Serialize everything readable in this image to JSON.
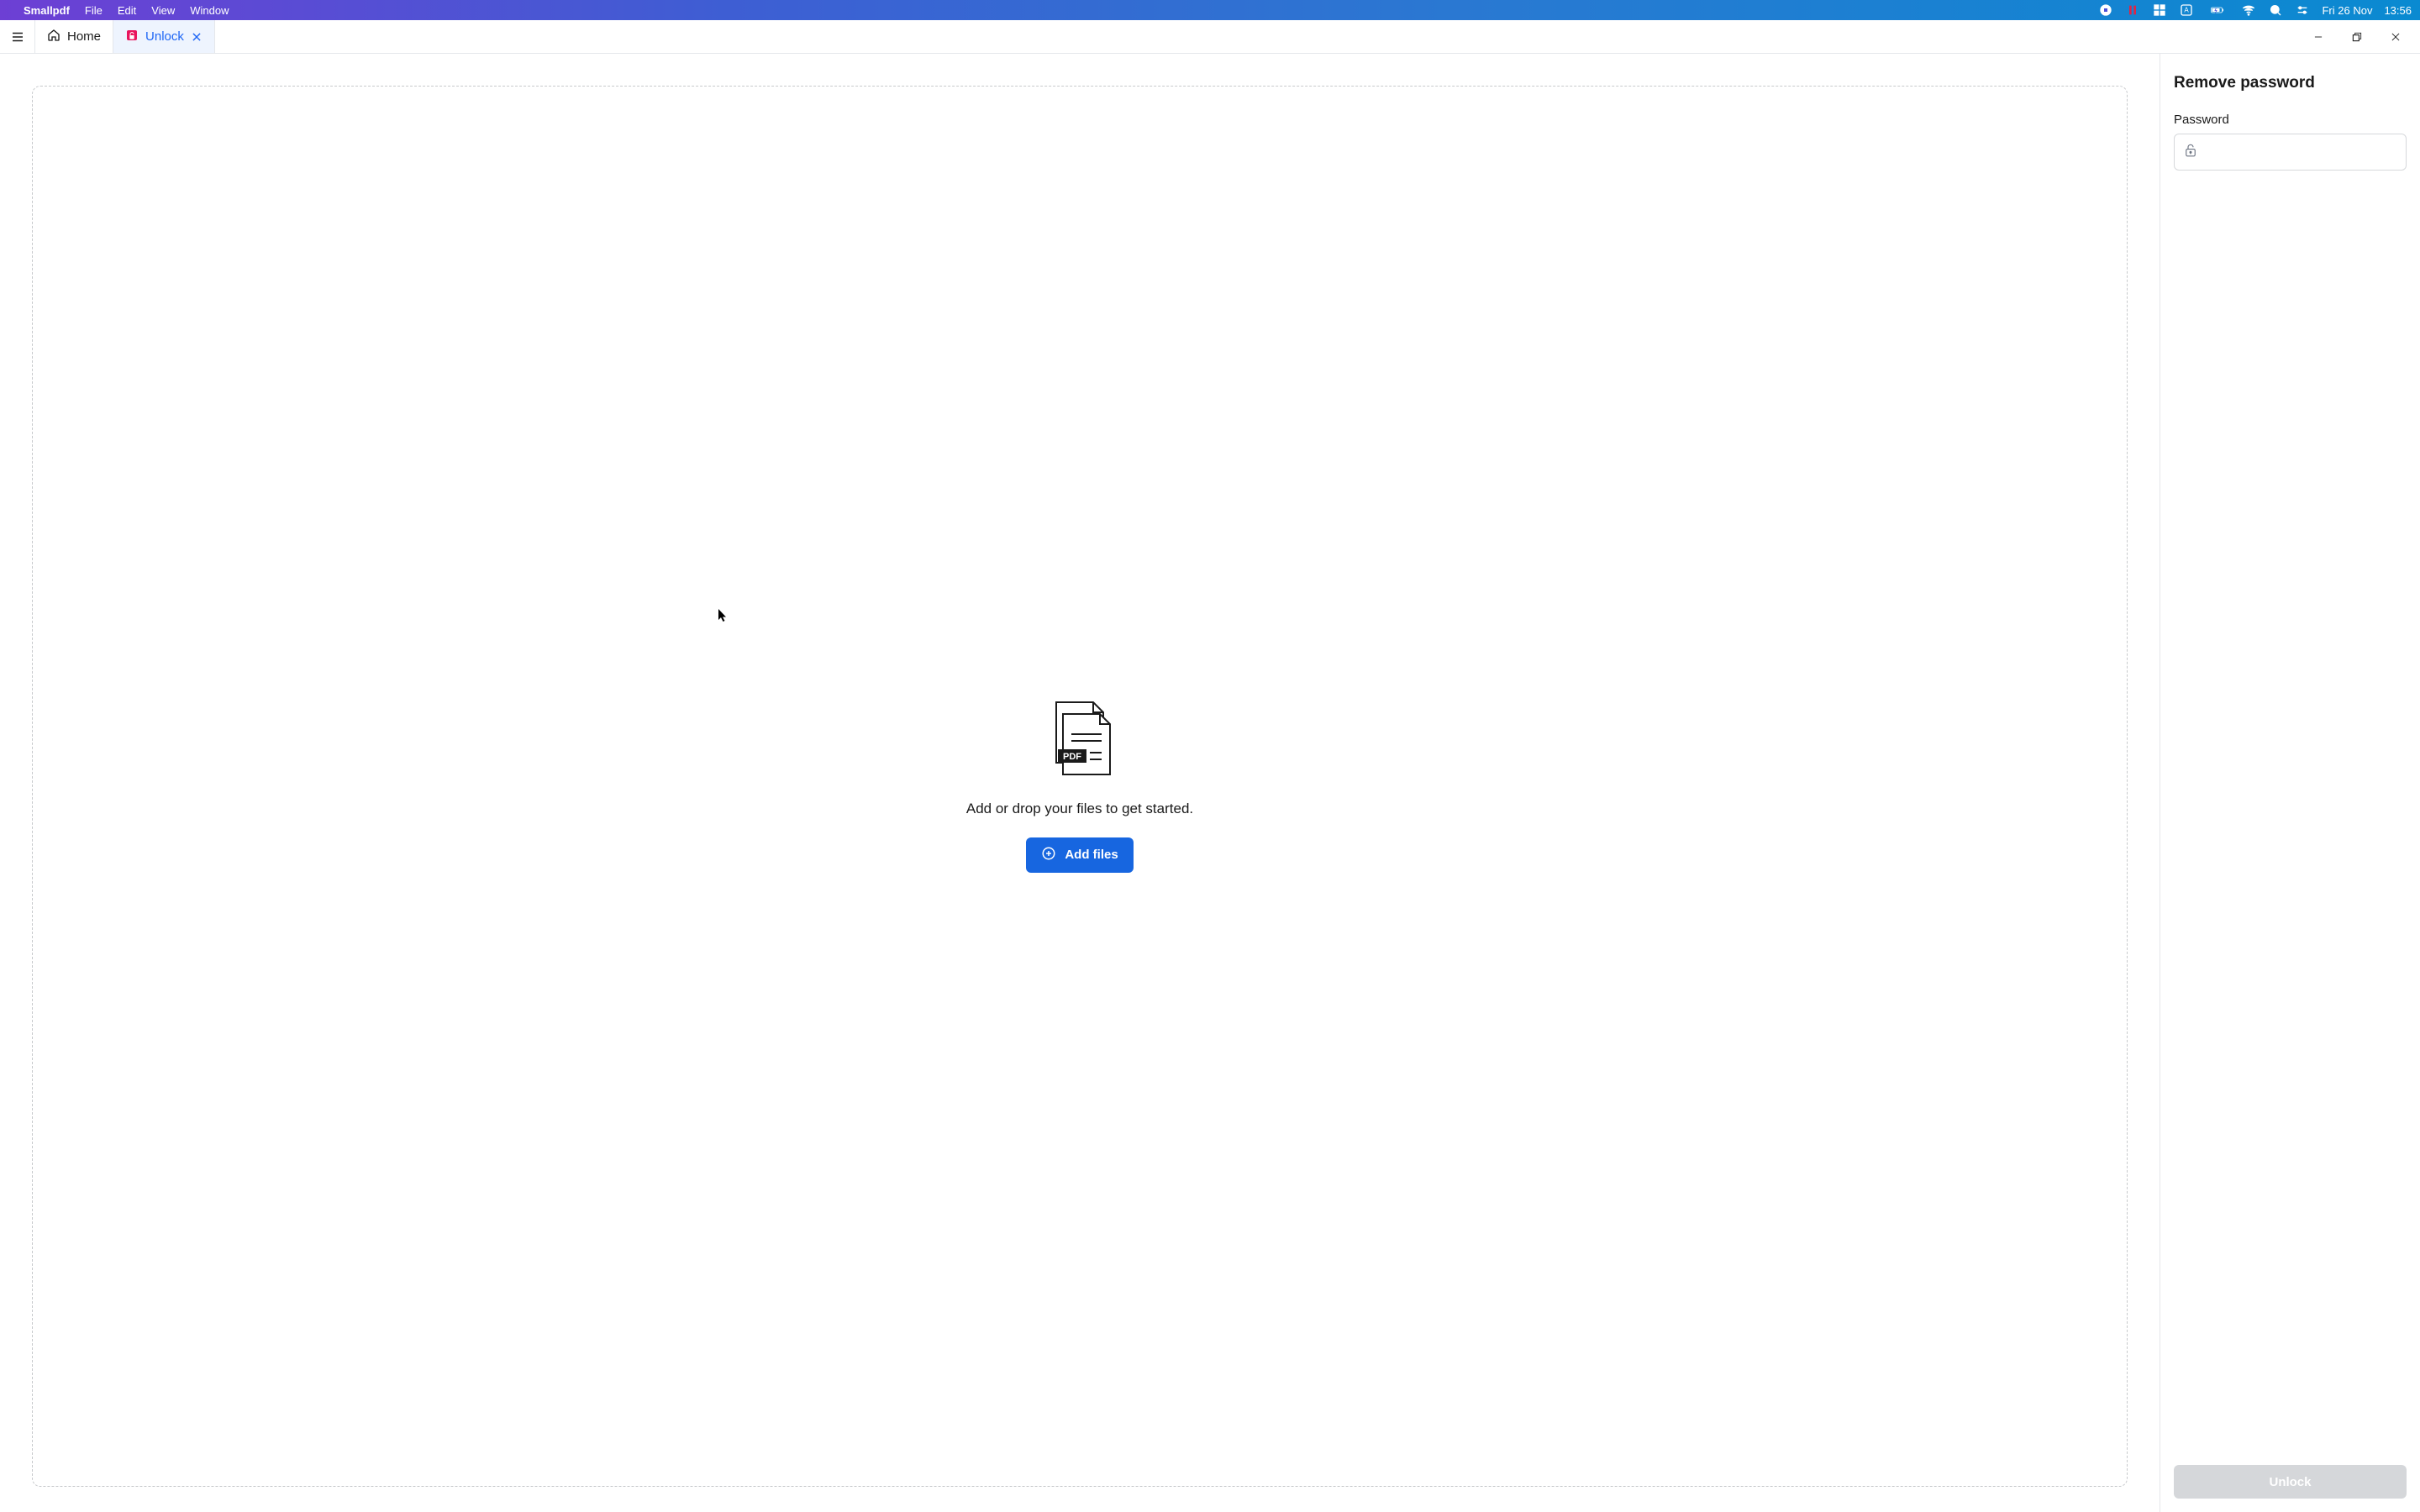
{
  "menubar": {
    "app_name": "Smallpdf",
    "items": [
      "File",
      "Edit",
      "View",
      "Window"
    ],
    "date": "Fri 26 Nov",
    "time": "13:56"
  },
  "tabs": {
    "home_label": "Home",
    "unlock_label": "Unlock"
  },
  "drop_zone": {
    "prompt": "Add or drop your files to get started.",
    "add_files_label": "Add files"
  },
  "sidebar": {
    "title": "Remove password",
    "password_label": "Password",
    "unlock_button": "Unlock"
  }
}
